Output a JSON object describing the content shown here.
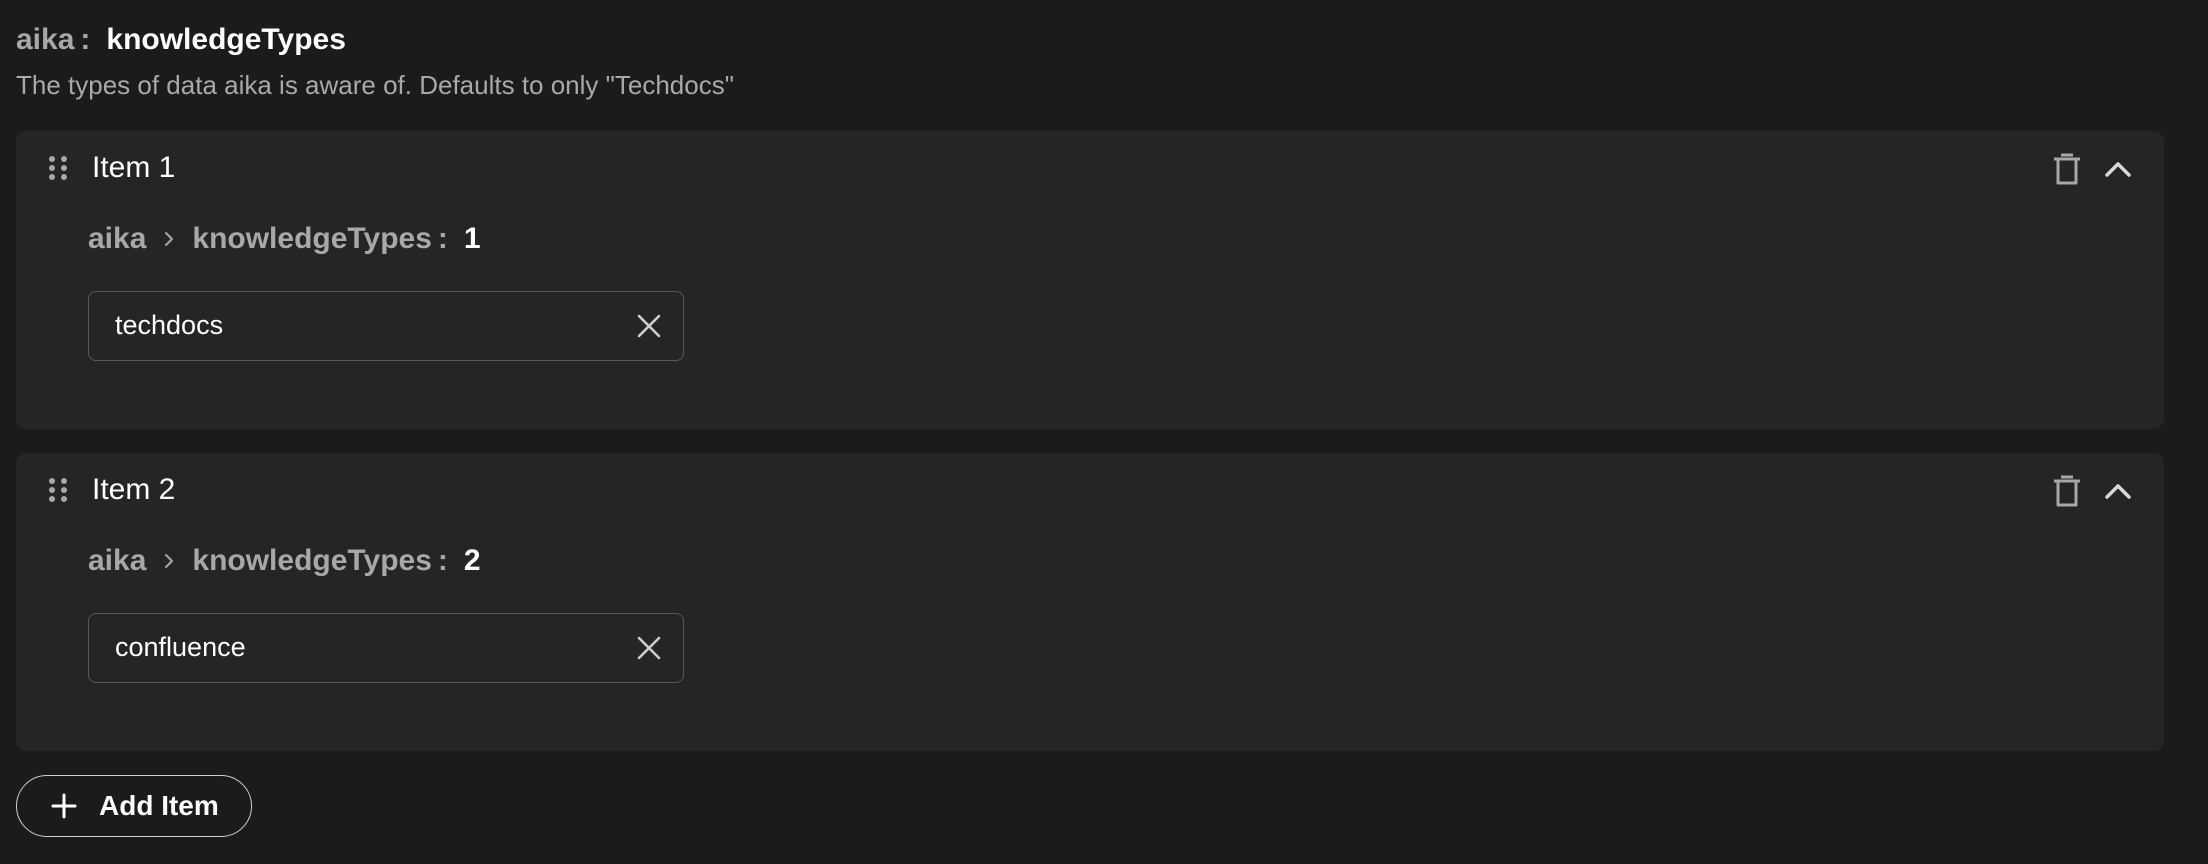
{
  "header": {
    "parent": "aika",
    "separator": ":",
    "key": "knowledgeTypes",
    "description": "The types of data aika is aware of. Defaults to only \"Techdocs\""
  },
  "items": [
    {
      "title": "Item 1",
      "breadcrumb": {
        "root": "aika",
        "field": "knowledgeTypes",
        "colon": ":",
        "index": "1"
      },
      "value": "techdocs"
    },
    {
      "title": "Item 2",
      "breadcrumb": {
        "root": "aika",
        "field": "knowledgeTypes",
        "colon": ":",
        "index": "2"
      },
      "value": "confluence"
    }
  ],
  "add_button": {
    "label": "Add Item"
  },
  "icons": {
    "drag": "drag-handle-icon",
    "delete": "trash-icon",
    "collapse": "chevron-up-icon",
    "breadcrumb_separator": "chevron-right-icon",
    "clear": "close-icon",
    "add": "plus-icon"
  },
  "colors": {
    "background": "#1b1b1b",
    "card": "#252525",
    "muted_text": "#a8a8a8",
    "text": "#ffffff",
    "field_border": "#585858"
  }
}
